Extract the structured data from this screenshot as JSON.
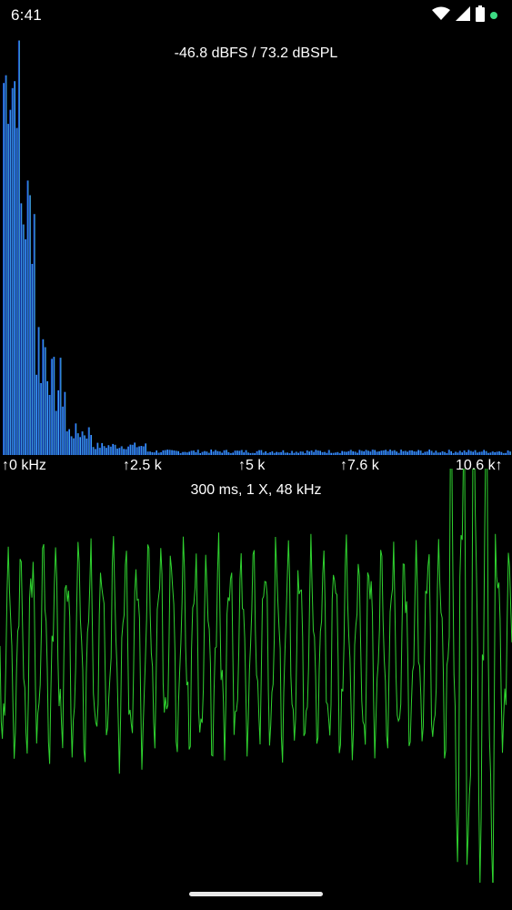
{
  "status_bar": {
    "time": "6:41",
    "icons": [
      "wifi-icon",
      "signal-icon",
      "battery-icon",
      "dot-icon"
    ],
    "dot_color": "#3ddc84"
  },
  "spectrum": {
    "readout": "-46.8 dBFS / 73.2 dBSPL",
    "bar_color_low": "#0a1fb8",
    "bar_color_high": "#4fd0ff",
    "freq_labels": [
      "↑0 kHz",
      "↑2.5 k",
      "↑5 k",
      "↑7.6 k",
      "10.6 k↑"
    ]
  },
  "oscilloscope": {
    "readout": "300 ms, 1 X, 48 kHz",
    "trace_color": "#2fd22f"
  },
  "nav": {
    "handle_color": "#e8e8e8"
  }
}
